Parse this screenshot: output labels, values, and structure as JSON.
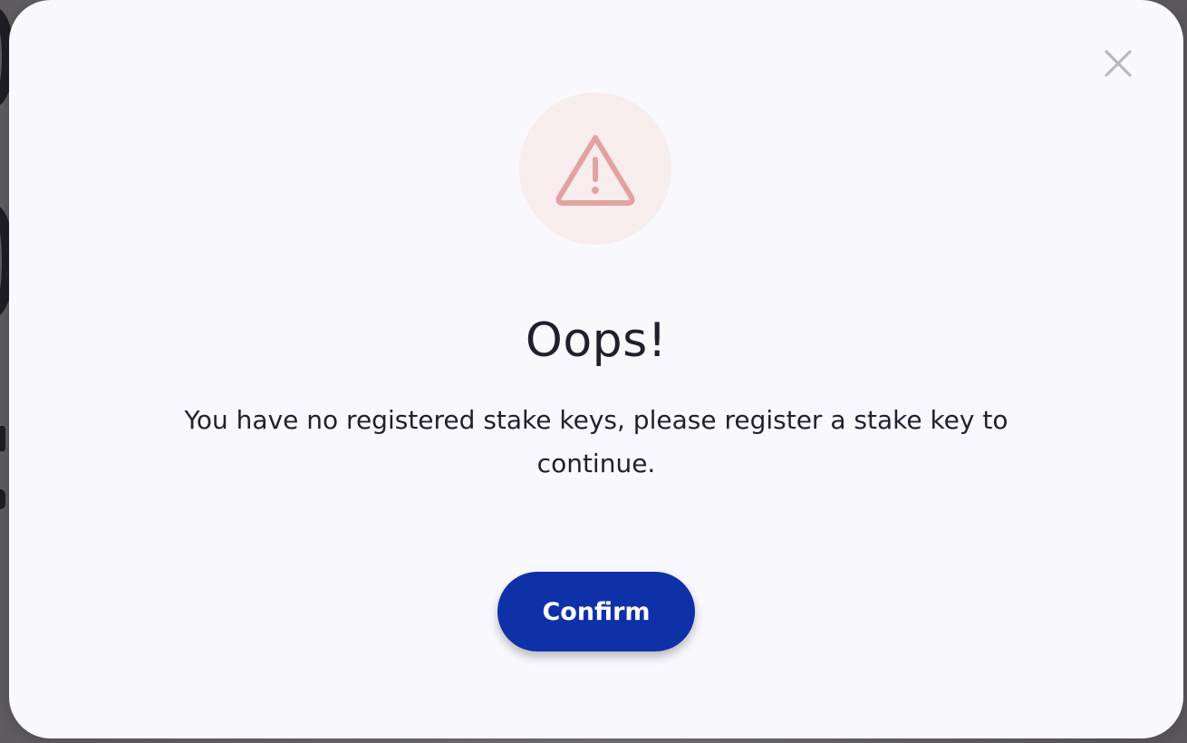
{
  "dialog": {
    "title": "Oops!",
    "message": "You have no registered stake keys, please register a stake key to continue.",
    "confirm_label": "Confirm",
    "close_icon": "close-icon",
    "alert_icon": "warning-triangle-icon"
  },
  "colors": {
    "primary": "#0f31a8",
    "alert_icon": "#e3a2a2",
    "alert_badge_bg": "#f8eded",
    "text": "#201f2e",
    "dialog_bg": "#f9f8fd",
    "close_icon": "#b9b8bf"
  }
}
